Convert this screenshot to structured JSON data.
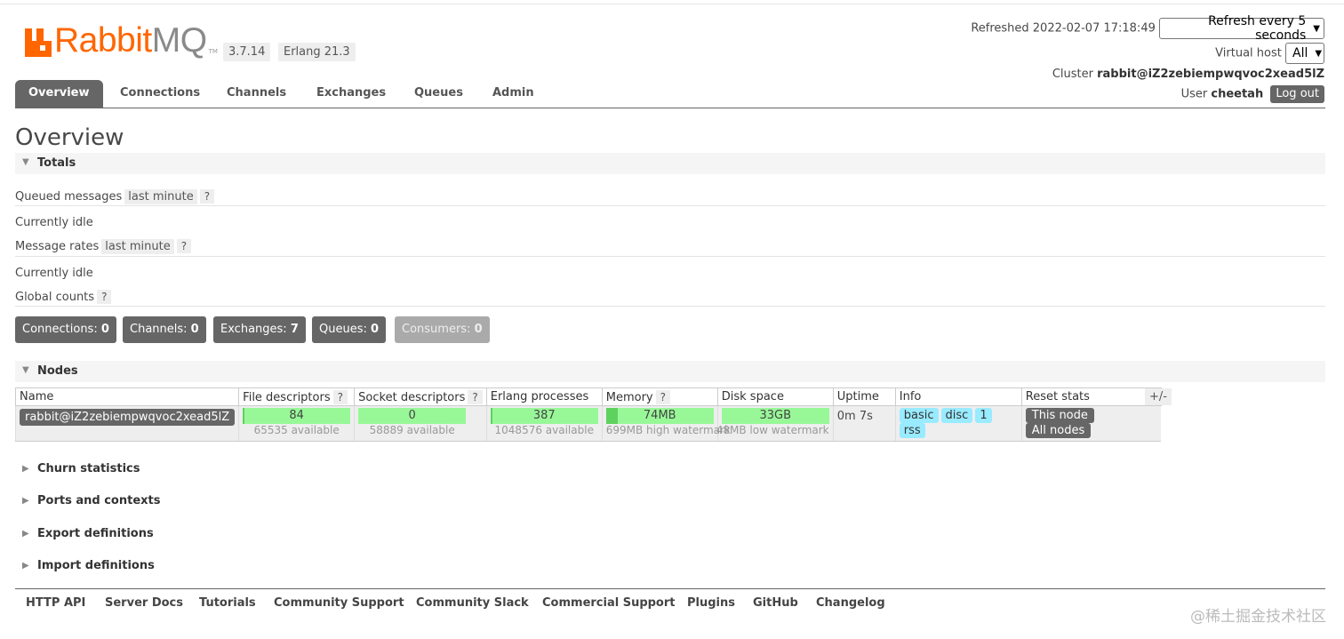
{
  "header": {
    "logo_rabbit": "Rabbit",
    "logo_mq": "MQ",
    "logo_tm": "TM",
    "version": "3.7.14",
    "erlang": "Erlang 21.3",
    "refreshed_label": "Refreshed 2022-02-07 17:18:49",
    "refresh_select": "Refresh every 5 seconds",
    "vhost_label": "Virtual host",
    "vhost_select": "All",
    "cluster_label": "Cluster",
    "cluster_name": "rabbit@iZ2zebiempwqvoc2xead5lZ",
    "user_label": "User",
    "user_name": "cheetah",
    "logout": "Log out"
  },
  "tabs": [
    "Overview",
    "Connections",
    "Channels",
    "Exchanges",
    "Queues",
    "Admin"
  ],
  "page_title": "Overview",
  "totals": {
    "section": "Totals",
    "queued_label": "Queued messages",
    "queued_range": "last minute",
    "help": "?",
    "idle1": "Currently idle",
    "rates_label": "Message rates",
    "rates_range": "last minute",
    "idle2": "Currently idle",
    "global_label": "Global counts"
  },
  "counts": [
    {
      "label": "Connections:",
      "value": "0"
    },
    {
      "label": "Channels:",
      "value": "0"
    },
    {
      "label": "Exchanges:",
      "value": "7"
    },
    {
      "label": "Queues:",
      "value": "0"
    },
    {
      "label": "Consumers:",
      "value": "0"
    }
  ],
  "nodes": {
    "section": "Nodes",
    "plusminus": "+/-",
    "columns": {
      "name": "Name",
      "fd": "File descriptors",
      "sd": "Socket descriptors",
      "ep": "Erlang processes",
      "mem": "Memory",
      "disk": "Disk space",
      "uptime": "Uptime",
      "info": "Info",
      "reset": "Reset stats"
    },
    "row": {
      "name": "rabbit@iZ2zebiempwqvoc2xead5lZ",
      "fd": "84",
      "fd_sub": "65535 available",
      "fd_used": 0.0013,
      "sd": "0",
      "sd_sub": "58889 available",
      "sd_used": 0,
      "ep": "387",
      "ep_sub": "1048576 available",
      "ep_used": 0.0004,
      "mem": "74MB",
      "mem_sub": "699MB high watermark",
      "mem_used": 0.106,
      "disk": "33GB",
      "disk_sub": "48MB low watermark",
      "uptime": "0m 7s",
      "info_tags": [
        "basic",
        "disc",
        "1",
        "rss"
      ],
      "this_node": "This node",
      "all_nodes": "All nodes"
    }
  },
  "collapsed_sections": [
    "Churn statistics",
    "Ports and contexts",
    "Export definitions",
    "Import definitions"
  ],
  "footer_links": [
    "HTTP API",
    "Server Docs",
    "Tutorials",
    "Community Support",
    "Community Slack",
    "Commercial Support",
    "Plugins",
    "GitHub",
    "Changelog"
  ],
  "watermark": "@稀土掘金技术社区",
  "colors": {
    "brand": "#ff6600",
    "tab_active": "#666666",
    "bar_green": "#98f898",
    "tag_blue": "#99ebff"
  }
}
